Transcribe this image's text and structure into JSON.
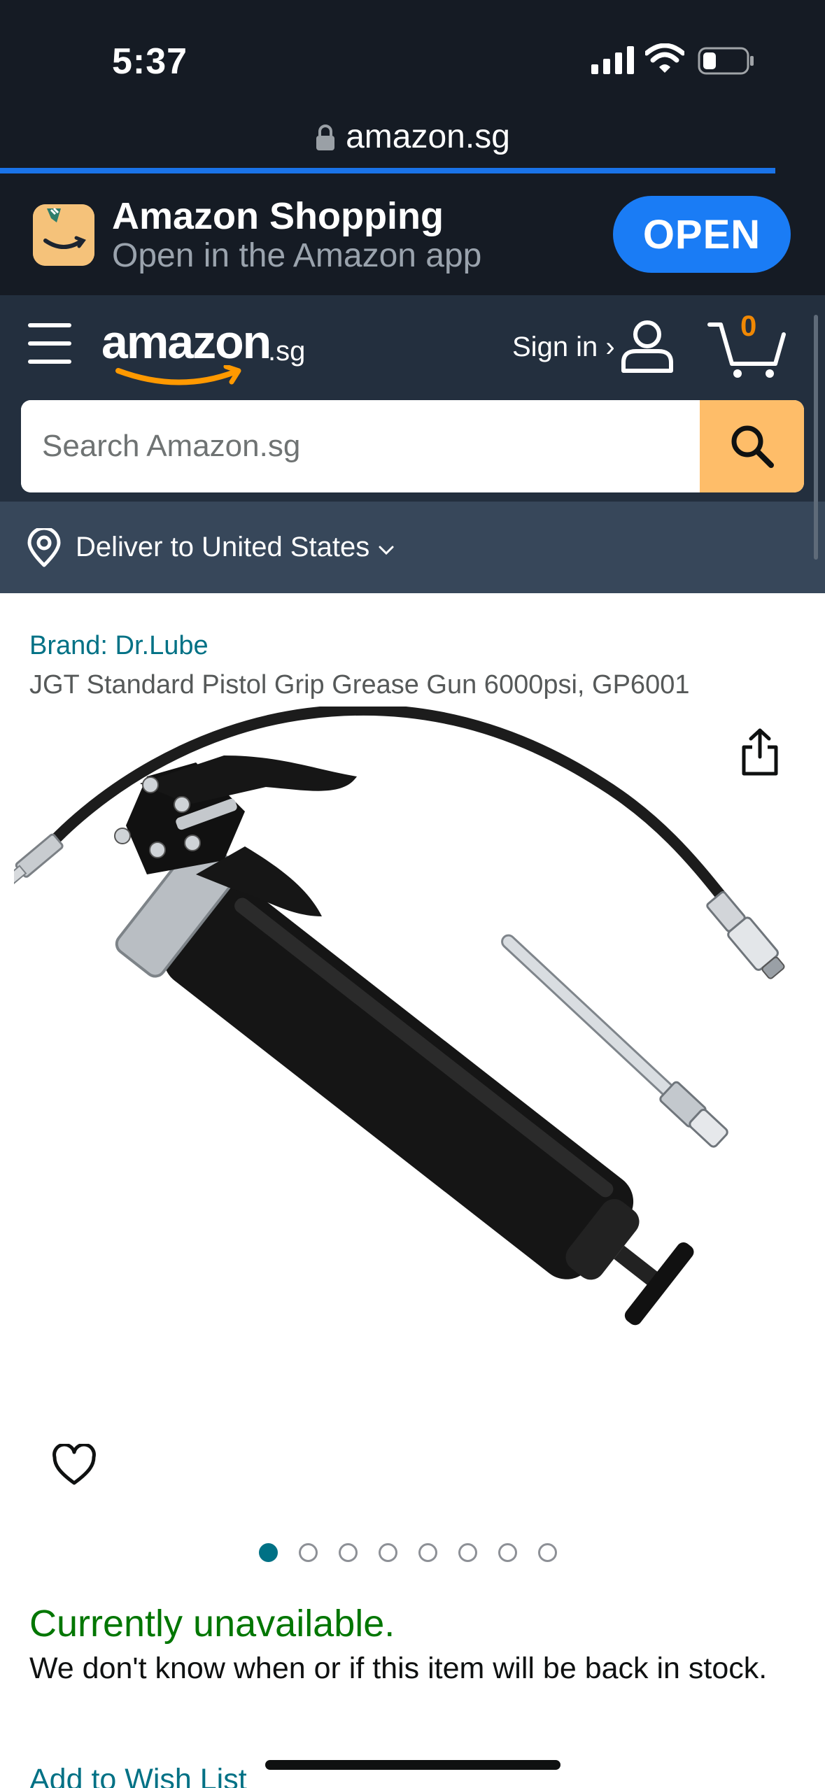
{
  "status_bar": {
    "time": "5:37"
  },
  "browser": {
    "url": "amazon.sg",
    "load_progress": 0.94
  },
  "app_banner": {
    "title": "Amazon Shopping",
    "subtitle": "Open in the Amazon app",
    "open_label": "OPEN"
  },
  "header": {
    "logo_word": "amazon",
    "logo_suffix": ".sg",
    "signin_label": "Sign in ›",
    "cart_count": "0",
    "icons": [
      "menu-icon",
      "person-icon",
      "cart-icon",
      "search-icon"
    ]
  },
  "search": {
    "placeholder": "Search Amazon.sg",
    "value": ""
  },
  "deliver": {
    "label": "Deliver to United States"
  },
  "product": {
    "brand": "Brand: Dr.Lube",
    "title": "JGT Standard Pistol Grip Grease Gun 6000psi, GP6001",
    "image_count": 8,
    "active_image": 1
  },
  "availability": {
    "status": "Currently unavailable.",
    "note": "We don't know when or if this item will be back in stock."
  },
  "actions": {
    "wishlist_label": "Add to Wish List"
  },
  "colors": {
    "header_bg": "#232f3e",
    "deliver_bg": "#37475a",
    "search_button": "#febd69",
    "link": "#007185",
    "available_green": "#007600",
    "open_button": "#1a7cf5"
  }
}
